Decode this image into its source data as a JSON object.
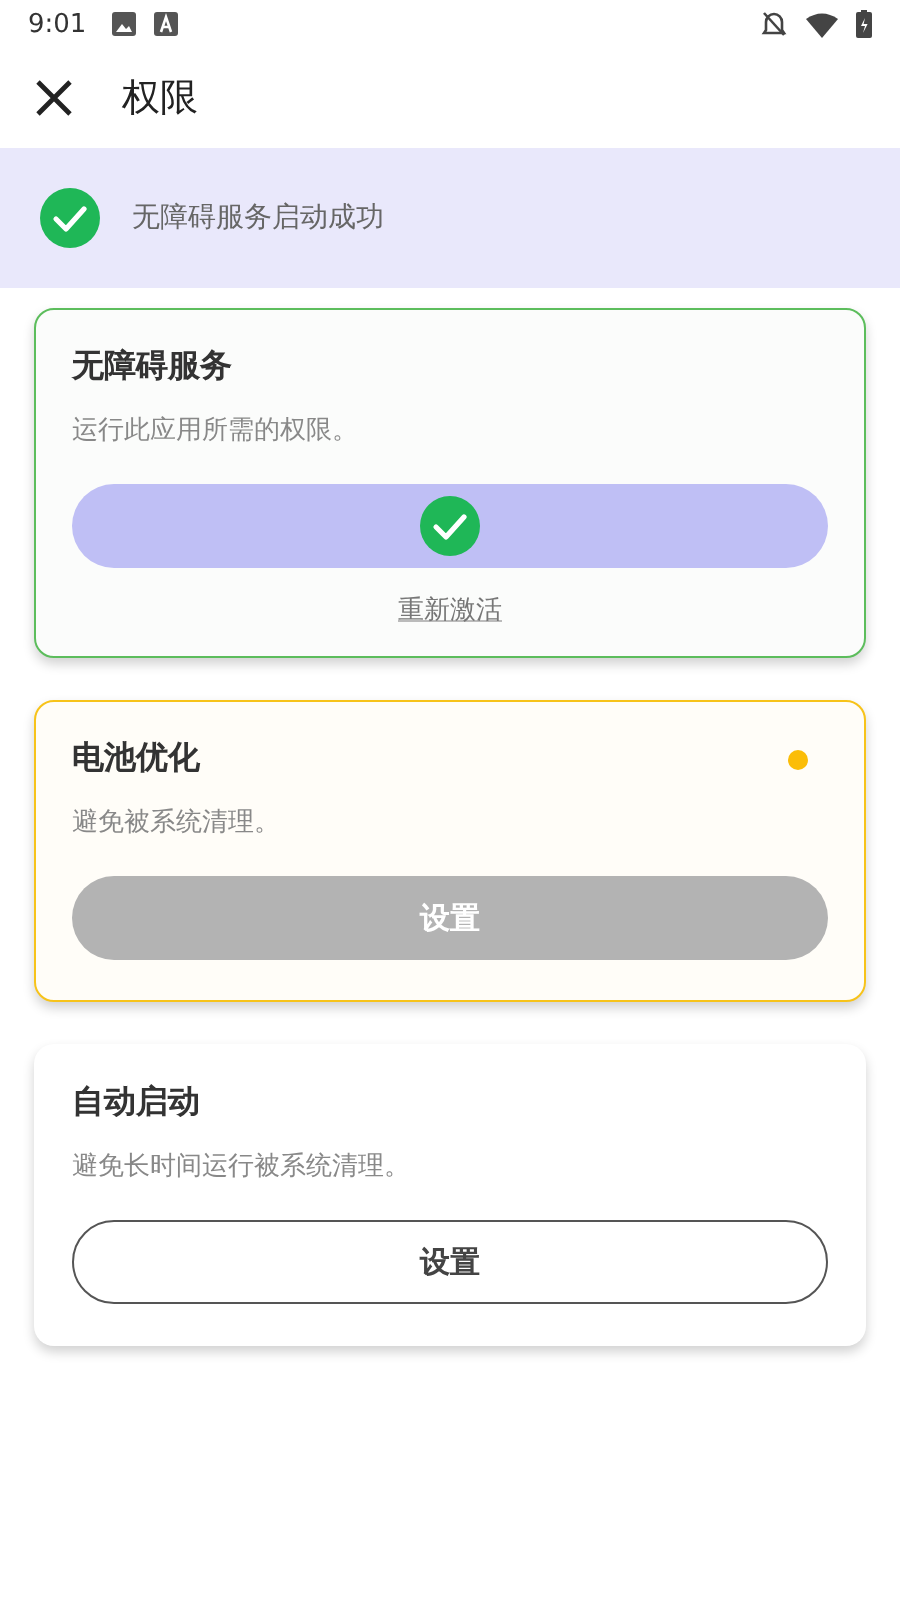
{
  "status_bar": {
    "time": "9:01"
  },
  "app_bar": {
    "title": "权限"
  },
  "banner": {
    "text": "无障碍服务启动成功"
  },
  "permissions": [
    {
      "title": "无障碍服务",
      "description": "运行此应用所需的权限。",
      "kind": "granted",
      "relink": "重新激活"
    },
    {
      "title": "电池优化",
      "description": "避免被系统清理。",
      "kind": "warning",
      "button": "设置"
    },
    {
      "title": "自动启动",
      "description": "避免长时间运行被系统清理。",
      "kind": "plain",
      "button": "设置"
    }
  ]
}
